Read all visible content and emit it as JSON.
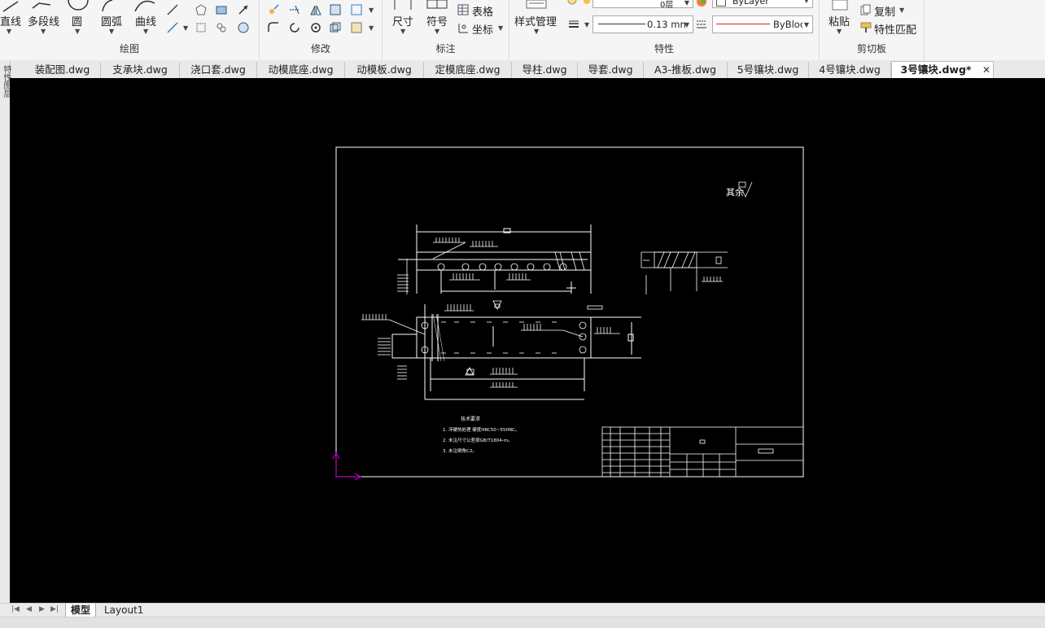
{
  "ribbon": {
    "draw": {
      "label": "绘图",
      "line": "直线",
      "polyline": "多段线",
      "circle": "圆",
      "arc": "圆弧",
      "curve": "曲线"
    },
    "modify": {
      "label": "修改"
    },
    "annotate": {
      "label": "标注",
      "dimension": "尺寸",
      "symbol": "符号",
      "table": "表格",
      "coordinate": "坐标"
    },
    "properties": {
      "label": "特性",
      "style_manager": "样式管理",
      "layer_value": "0层",
      "lineweight": "0.13 mn",
      "color_value": "ByLayer",
      "linetype_value": "ByBloc"
    },
    "clipboard": {
      "label": "剪切板",
      "paste": "粘贴",
      "copy": "复制",
      "match_props": "特性匹配"
    }
  },
  "tabs": [
    {
      "label": "装配图.dwg"
    },
    {
      "label": "支承块.dwg"
    },
    {
      "label": "浇口套.dwg"
    },
    {
      "label": "动模底座.dwg"
    },
    {
      "label": "动模板.dwg"
    },
    {
      "label": "定模底座.dwg"
    },
    {
      "label": "导柱.dwg"
    },
    {
      "label": "导套.dwg"
    },
    {
      "label": "A3-推板.dwg"
    },
    {
      "label": "5号镶块.dwg"
    },
    {
      "label": "4号镶块.dwg"
    },
    {
      "label": "3号镶块.dwg*",
      "active": true
    }
  ],
  "left_panel_text": "特性图层",
  "drawing": {
    "roughness_note": "其余",
    "tech_title": "技术要求",
    "tech_notes": [
      "1. 淬硬热处理 硬度HRC50~55HRC。",
      "2. 未注尺寸公差按GB/T1804-m。",
      "3. 未注倒角C2。"
    ]
  },
  "layout_tabs": [
    {
      "label": "模型",
      "active": true
    },
    {
      "label": "Layout1"
    }
  ],
  "colors": {
    "canvas": "#000000",
    "geometry": "#ffffff",
    "ucs": "#c000c0"
  }
}
